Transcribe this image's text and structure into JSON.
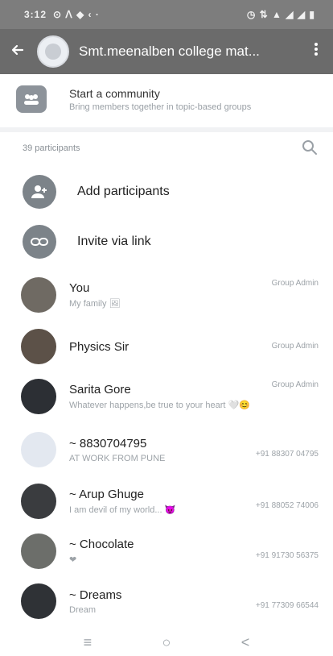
{
  "status": {
    "time": "3:12",
    "icons_left": "⊙ ᐱ ◆ ‹ ·",
    "icons_right": "◷ ⇅ ▲ ◢ ◢ ▮"
  },
  "header": {
    "title": "Smt.meenalben college mat...",
    "back_icon": "arrow-left-icon",
    "menu_icon": "kebab-icon"
  },
  "community": {
    "title": "Start a community",
    "subtitle": "Bring members together in topic-based groups"
  },
  "participants": {
    "count_label": "39 participants"
  },
  "actions": {
    "add": "Add participants",
    "invite": "Invite via link"
  },
  "members": [
    {
      "name": "You",
      "about": "My family 🖼",
      "right_top": "Group Admin",
      "right_mid": "",
      "avatar_color": "#6f6a63"
    },
    {
      "name": "Physics Sir",
      "about": "",
      "right_top": "Group Admin",
      "right_mid": "",
      "avatar_color": "#5c5148"
    },
    {
      "name": "Sarita Gore",
      "about": "Whatever happens,be true to your heart 🤍😊",
      "right_top": "Group Admin",
      "right_mid": "",
      "avatar_color": "#2c2f34"
    },
    {
      "name": "~ 8830704795",
      "about": "AT WORK FROM PUNE",
      "right_top": "",
      "right_mid": "+91 88307 04795",
      "avatar_color": "#e3e8f0"
    },
    {
      "name": "~ Arup Ghuge",
      "about": "I am devil of my world... 😈",
      "right_top": "",
      "right_mid": "+91 88052 74006",
      "avatar_color": "#3a3c3f"
    },
    {
      "name": "~ Chocolate",
      "about": "❤",
      "right_top": "",
      "right_mid": "+91 91730 56375",
      "avatar_color": "#6c6e6a"
    },
    {
      "name": "~ Dreams",
      "about": "Dream",
      "right_top": "",
      "right_mid": "+91 77309 66544",
      "avatar_color": "#2f3236"
    }
  ],
  "nav": {
    "recent": "≡",
    "home": "○",
    "back": "<"
  }
}
